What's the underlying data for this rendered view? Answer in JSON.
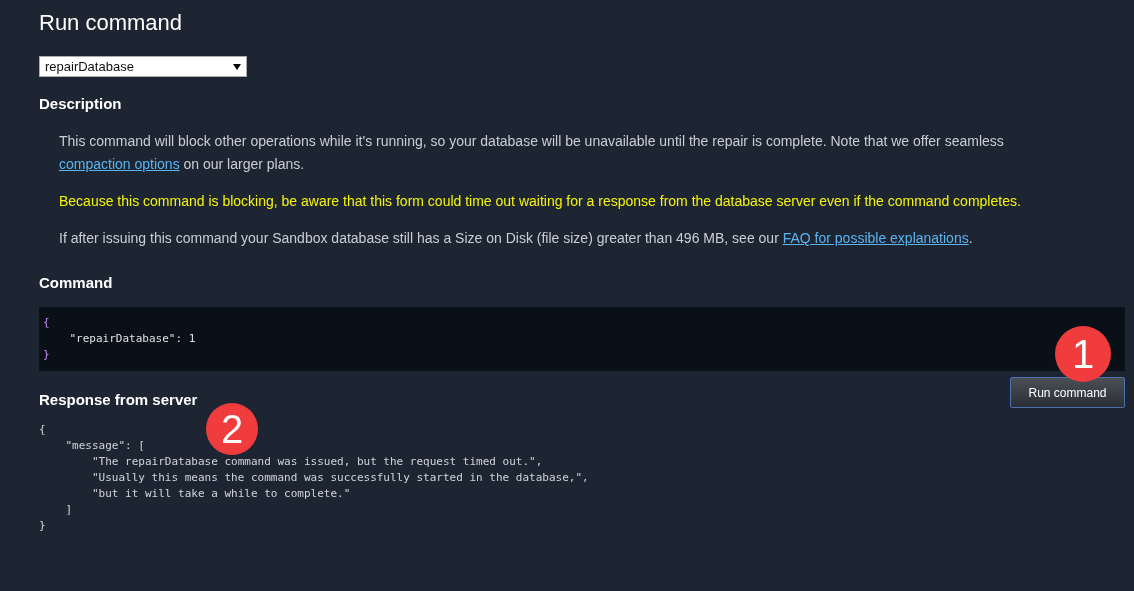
{
  "title": "Run command",
  "command_select": {
    "value": "repairDatabase"
  },
  "description": {
    "heading": "Description",
    "paragraphs": [
      {
        "kind": "note",
        "parts": [
          {
            "text": "This command will block other operations while it's running, so your database will be unavailable until the repair is complete. Note that we offer seamless "
          },
          {
            "link": "compaction options"
          },
          {
            "text": " on our larger plans."
          }
        ]
      },
      {
        "kind": "warning",
        "parts": [
          {
            "text": "Because this command is blocking, be aware that this form could time out waiting for a response from the database server even if the command completes."
          }
        ]
      },
      {
        "kind": "note",
        "parts": [
          {
            "text": "If after issuing this command your Sandbox database still has a Size on Disk (file size) greater than 496 MB, see our "
          },
          {
            "link": "FAQ for possible explanations"
          },
          {
            "text": "."
          }
        ]
      }
    ]
  },
  "command": {
    "heading": "Command",
    "lines": [
      "{",
      "    \"repairDatabase\": 1",
      "}"
    ]
  },
  "run_button": "Run command",
  "response": {
    "heading": "Response from server",
    "lines": [
      "{",
      "    \"message\": [",
      "        \"The repairDatabase command was issued, but the request timed out.\",",
      "        \"Usually this means the command was successfully started in the database,\",",
      "        \"but it will take a while to complete.\"",
      "    ]",
      "}"
    ]
  },
  "callouts": [
    "1",
    "2"
  ]
}
